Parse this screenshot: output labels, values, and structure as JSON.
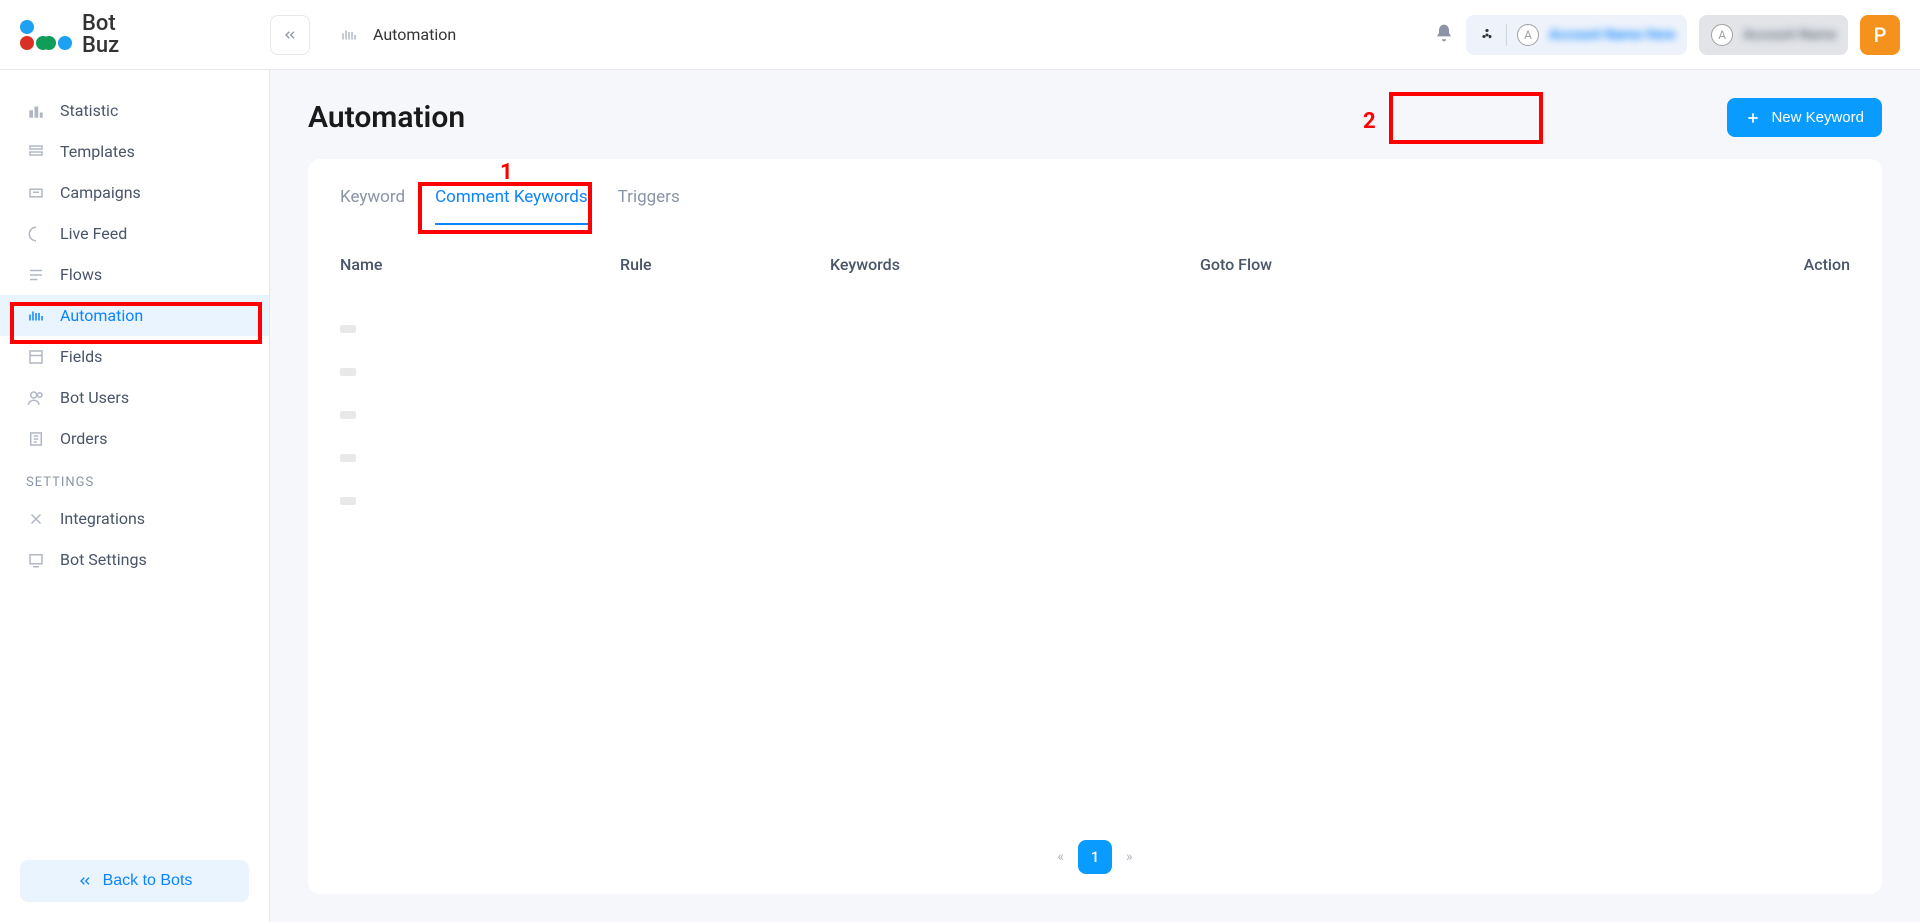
{
  "brand": {
    "name": "Bot\nBuz"
  },
  "breadcrumb": {
    "label": "Automation"
  },
  "topbar": {
    "tagA": {
      "letter": "A",
      "hidden": "Account Name Here"
    },
    "tagB": {
      "letter": "A",
      "hidden": "Account Name"
    },
    "profile_letter": "P"
  },
  "sidebar": {
    "items": [
      {
        "label": "Statistic"
      },
      {
        "label": "Templates"
      },
      {
        "label": "Campaigns"
      },
      {
        "label": "Live Feed"
      },
      {
        "label": "Flows"
      },
      {
        "label": "Automation"
      },
      {
        "label": "Fields"
      },
      {
        "label": "Bot Users"
      },
      {
        "label": "Orders"
      }
    ],
    "settings_header": "SETTINGS",
    "settings_items": [
      {
        "label": "Integrations"
      },
      {
        "label": "Bot Settings"
      }
    ],
    "back_label": "Back to Bots"
  },
  "page": {
    "title": "Automation",
    "new_keyword_label": "New Keyword"
  },
  "tabs": {
    "keyword": "Keyword",
    "comment_keywords": "Comment Keywords",
    "triggers": "Triggers"
  },
  "table": {
    "cols": {
      "name": "Name",
      "rule": "Rule",
      "keywords": "Keywords",
      "goto": "Goto Flow",
      "action": "Action"
    }
  },
  "pagination": {
    "page": "1"
  },
  "annotations": {
    "one": "1",
    "two": "2"
  }
}
